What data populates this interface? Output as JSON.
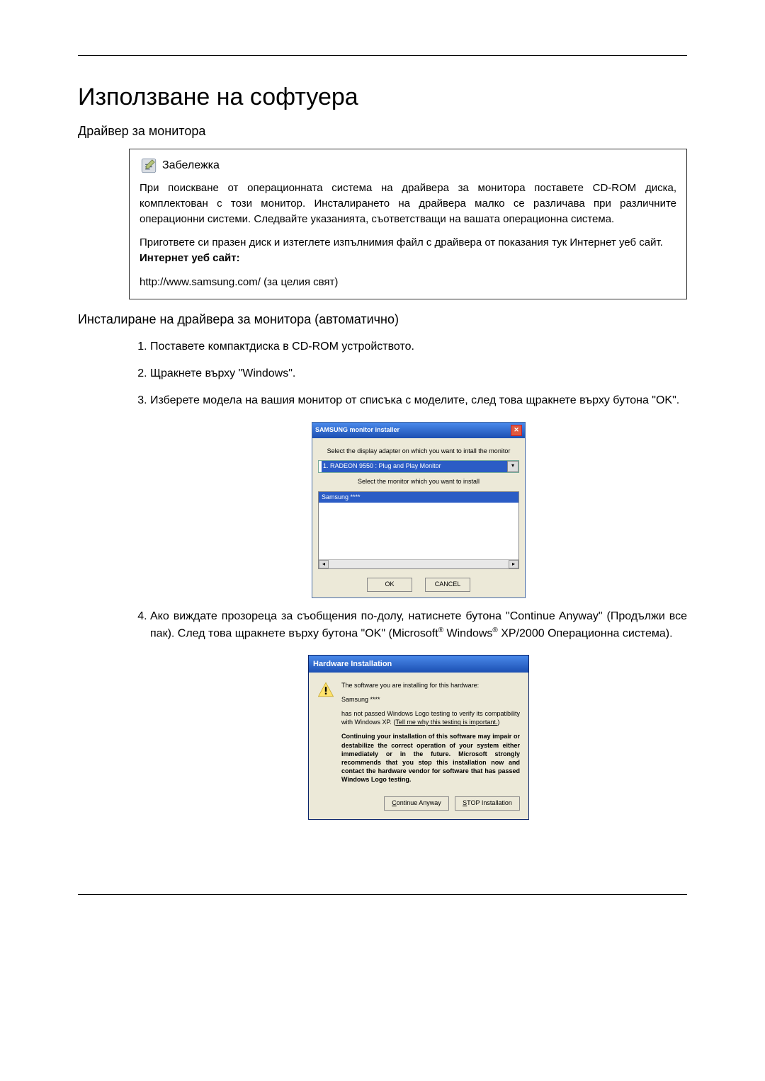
{
  "title": "Използване на софтуера",
  "section1_heading": "Драйвер за монитора",
  "note": {
    "label": "Забележка",
    "p1": "При поискване от операционната система на драйвера за монитора поставете CD-ROM диска, комплектован с този монитор. Инсталирането на драйвера малко се различава при различните операционни системи. Следвайте указанията, съответстващи на вашата операционна система.",
    "p2": "Пригответе си празен диск и изтеглете изпълнимия файл с драйвера от показания тук Интернет уеб сайт.",
    "site_label": "Интернет уеб сайт:",
    "url": "http://www.samsung.com/ (за целия свят)"
  },
  "section2_heading": "Инсталиране на драйвера за монитора (автоматично)",
  "steps": {
    "s1": "Поставете компактдиска в CD-ROM устройството.",
    "s2": "Щракнете върху \"Windows\".",
    "s3": "Изберете модела на вашия монитор от списъка с моделите, след това щракнете върху бутона \"OK\".",
    "s4a": "Ако виждате прозореца за съобщения по-долу, натиснете бутона \"Continue Anyway\" (Продължи все пак). След това щракнете върху бутона \"OK\" (Microsoft",
    "s4b": " Windows",
    "s4c": " XP/2000 Операционна система)."
  },
  "samsung_dialog": {
    "title": "SAMSUNG monitor installer",
    "line1": "Select the display adapter on which you want to intall the monitor",
    "combo_selected": "1. RADEON 9550 : Plug and Play Monitor",
    "line2": "Select the monitor which you want to install",
    "list_item": "Samsung ****",
    "ok": "OK",
    "cancel": "CANCEL"
  },
  "hw_dialog": {
    "title": "Hardware Installation",
    "p1": "The software you are installing for this hardware:",
    "p2": "Samsung ****",
    "p3a": "has not passed Windows Logo testing to verify its compatibility with Windows XP. (",
    "p3link": "Tell me why this testing is important.",
    "p3b": ")",
    "p4": "Continuing your installation of this software may impair or destabilize the correct operation of your system either immediately or in the future. Microsoft strongly recommends that you stop this installation now and contact the hardware vendor for software that has passed Windows Logo testing.",
    "btn_continue_u": "C",
    "btn_continue_rest": "ontinue Anyway",
    "btn_stop_u": "S",
    "btn_stop_rest": "TOP Installation"
  }
}
